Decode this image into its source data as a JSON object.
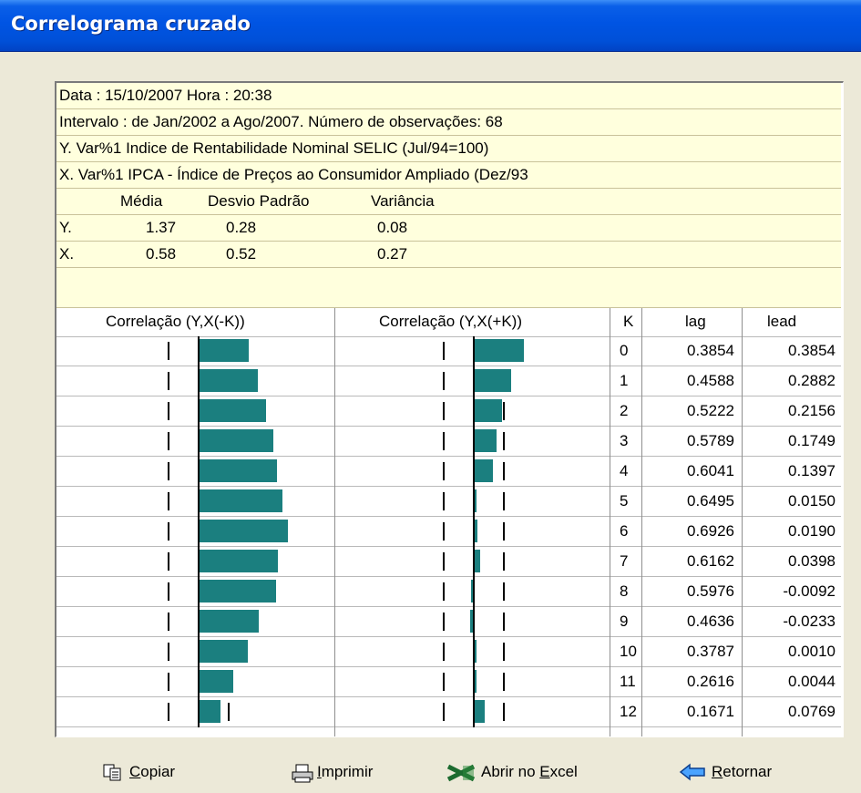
{
  "window": {
    "title": "Correlograma cruzado"
  },
  "header": {
    "date_line": "Data : 15/10/2007  Hora : 20:38",
    "interval_line": "Intervalo :  de Jan/2002 a Ago/2007.   Número de observações: 68",
    "y_desc": "Y. Var%1 Indice de Rentabilidade Nominal SELIC (Jul/94=100)",
    "x_desc": "X. Var%1 IPCA - Índice de Preços ao Consumidor Ampliado (Dez/93",
    "stats_headers": {
      "media": "Média",
      "desvio": "Desvio Padrão",
      "variancia": "Variância"
    },
    "y_stats": {
      "label": "Y.",
      "media": "1.37",
      "desvio": "0.28",
      "variancia": "0.08"
    },
    "x_stats": {
      "label": "X.",
      "media": "0.58",
      "desvio": "0.52",
      "variancia": "0.27"
    }
  },
  "columns": {
    "left_chart": "Correlação (Y,X(-K))",
    "right_chart": "Correlação (Y,X(+K))",
    "k": "K",
    "lag": "lag",
    "lead": "lead"
  },
  "rows": [
    {
      "k": "0",
      "lag": "0.3854",
      "lead": "0.3854"
    },
    {
      "k": "1",
      "lag": "0.4588",
      "lead": "0.2882"
    },
    {
      "k": "2",
      "lag": "0.5222",
      "lead": "0.2156"
    },
    {
      "k": "3",
      "lag": "0.5789",
      "lead": "0.1749"
    },
    {
      "k": "4",
      "lag": "0.6041",
      "lead": "0.1397"
    },
    {
      "k": "5",
      "lag": "0.6495",
      "lead": "0.0150"
    },
    {
      "k": "6",
      "lag": "0.6926",
      "lead": "0.0190"
    },
    {
      "k": "7",
      "lag": "0.6162",
      "lead": "0.0398"
    },
    {
      "k": "8",
      "lag": "0.5976",
      "lead": "-0.0092"
    },
    {
      "k": "9",
      "lag": "0.4636",
      "lead": "-0.0233"
    },
    {
      "k": "10",
      "lag": "0.3787",
      "lead": "0.0010"
    },
    {
      "k": "11",
      "lag": "0.2616",
      "lead": "0.0044"
    },
    {
      "k": "12",
      "lag": "0.1671",
      "lead": "0.0769"
    }
  ],
  "chart_colors": {
    "bar": "#1b7f7f"
  },
  "buttons": {
    "copy": {
      "pre": "",
      "key": "C",
      "post": "opiar",
      "icon": "copy-icon"
    },
    "print": {
      "pre": "",
      "key": "I",
      "post": "mprimir",
      "icon": "printer-icon"
    },
    "excel": {
      "pre": "Abrir no ",
      "key": "E",
      "post": "xcel",
      "icon": "excel-icon"
    },
    "back": {
      "pre": "",
      "key": "R",
      "post": "etornar",
      "icon": "arrow-left-icon"
    }
  }
}
